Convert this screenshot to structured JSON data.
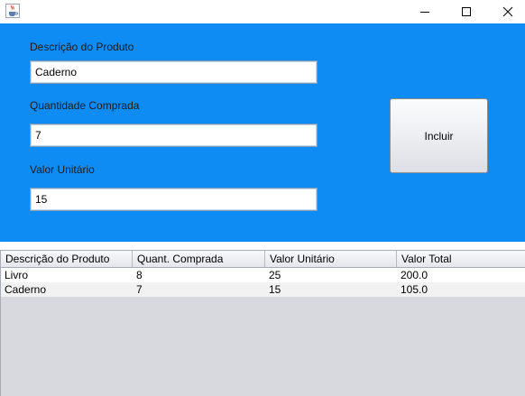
{
  "window": {
    "icon": "java-cup-icon",
    "controls": {
      "minimize_icon": "minimize-icon",
      "maximize_icon": "maximize-icon",
      "close_icon": "close-icon"
    }
  },
  "form": {
    "background_color": "#0f8cf4",
    "description_label": "Descrição do Produto",
    "description_value": "Caderno",
    "quantity_label": "Quantidade Comprada",
    "quantity_value": "7",
    "unit_value_label": "Valor Unitário",
    "unit_value_value": "15",
    "include_button_label": "Incluir"
  },
  "table": {
    "columns": [
      "Descrição do Produto",
      "Quant. Comprada",
      "Valor Unitário",
      "Valor Total"
    ],
    "rows": [
      [
        "Livro",
        "8",
        "25",
        "200.0"
      ],
      [
        "Caderno",
        "7",
        "15",
        "105.0"
      ]
    ]
  }
}
